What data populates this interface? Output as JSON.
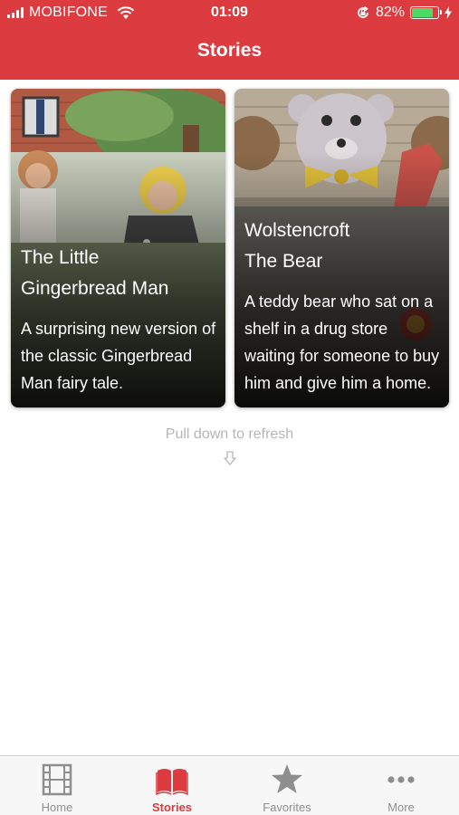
{
  "status_bar": {
    "carrier": "MOBIFONE",
    "time": "01:09",
    "battery_percent": "82%",
    "battery_level": 0.82,
    "signal_icon": "signal-bars-icon",
    "wifi_icon": "wifi-icon"
  },
  "nav": {
    "title": "Stories"
  },
  "stories": [
    {
      "title_line1": "The Little",
      "title_line2": "Gingerbread Man",
      "description": "A surprising new version of the classic Gingerbread Man fairy tale."
    },
    {
      "title_line1": "Wolstencroft",
      "title_line2": "The Bear",
      "description": "A teddy bear who sat on a shelf in a drug store waiting for someone to buy him and give him a home."
    }
  ],
  "refresh_hint": "Pull down to refresh",
  "tabs": [
    {
      "label": "Home",
      "icon": "film-icon",
      "active": false
    },
    {
      "label": "Stories",
      "icon": "open-book-icon",
      "active": true
    },
    {
      "label": "Favorites",
      "icon": "star-icon",
      "active": false
    },
    {
      "label": "More",
      "icon": "more-dots-icon",
      "active": false
    }
  ],
  "colors": {
    "brand_red": "#dc3b3f",
    "tab_inactive": "#8e8e8e",
    "battery_green": "#4cd964",
    "hint_gray": "#b6b6b6"
  }
}
